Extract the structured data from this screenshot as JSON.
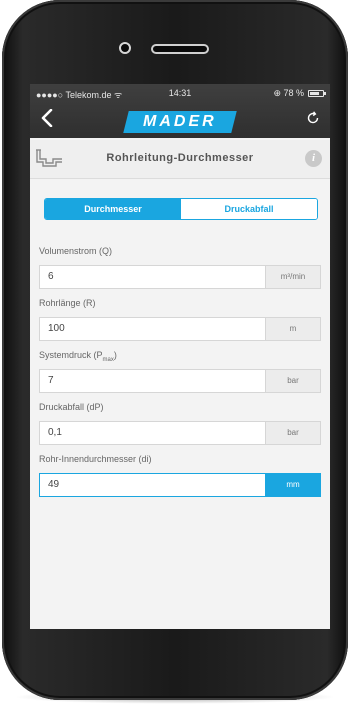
{
  "status_bar": {
    "carrier": "●●●●○ Telekom.de ᯤ",
    "time": "14:31",
    "battery": "⊕ 78 %",
    "battery_level": 0.78
  },
  "nav": {
    "back_icon": "chevron-left-icon",
    "logo": "MADER",
    "refresh_icon": "refresh-icon",
    "brand_color": "#1aa6e0"
  },
  "header": {
    "title": "Rohrleitung-Durchmesser",
    "info_icon": "i"
  },
  "tabs": [
    {
      "label": "Durchmesser",
      "active": true
    },
    {
      "label": "Druckabfall",
      "active": false
    }
  ],
  "fields": [
    {
      "label": "Volumenstrom (Q)",
      "value": "6",
      "unit": "m³/min"
    },
    {
      "label": "Rohrlänge (R)",
      "value": "100",
      "unit": "m"
    },
    {
      "label": "Systemdruck (P",
      "label_sub": "max",
      "label_tail": ")",
      "value": "7",
      "unit": "bar"
    },
    {
      "label": "Druckabfall (dP)",
      "value": "0,1",
      "unit": "bar"
    },
    {
      "label": "Rohr-Innendurchmesser (di)",
      "value": "49",
      "unit": "mm",
      "active": true
    }
  ]
}
